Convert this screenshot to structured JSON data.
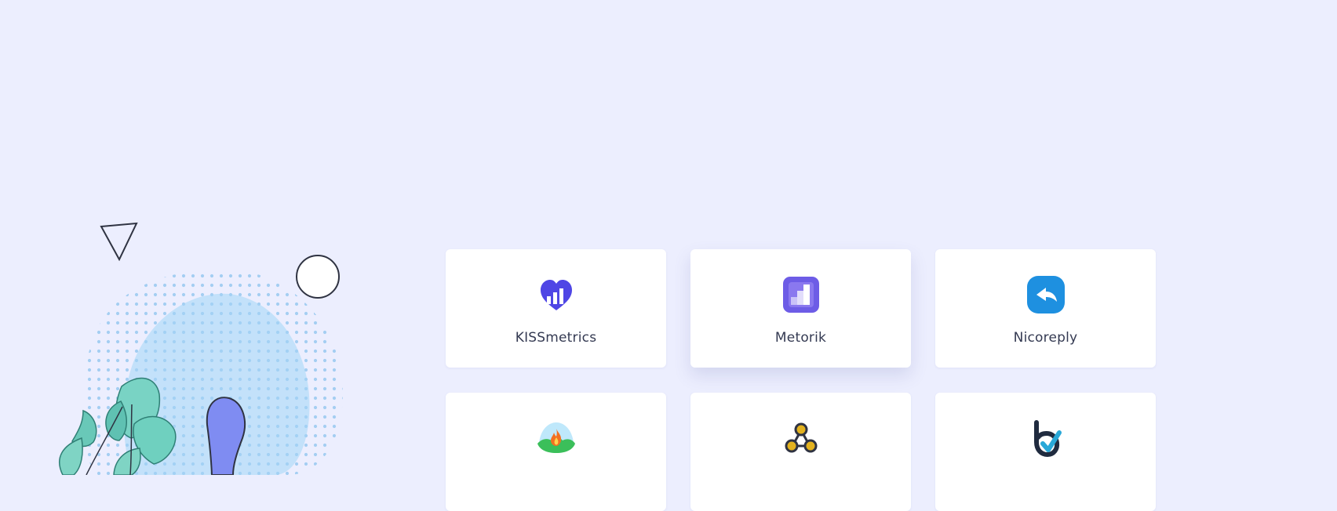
{
  "integrations": [
    {
      "name": "KISSmetrics",
      "icon": "kissmetrics-icon",
      "color": "#4f46e5"
    },
    {
      "name": "Metorik",
      "icon": "metorik-icon",
      "color": "#6d5ce6"
    },
    {
      "name": "Nicoreply",
      "icon": "nicoreply-icon",
      "color": "#1e90e0"
    },
    {
      "name": "",
      "icon": "campfire-icon",
      "color": "#3bbf5a"
    },
    {
      "name": "",
      "icon": "nodes-icon",
      "color": "#e3b21f"
    },
    {
      "name": "",
      "icon": "checkmark-brand-icon",
      "color": "#29a8d8"
    }
  ],
  "colors": {
    "background": "#eceefe",
    "card": "#ffffff",
    "text": "#343a52"
  }
}
